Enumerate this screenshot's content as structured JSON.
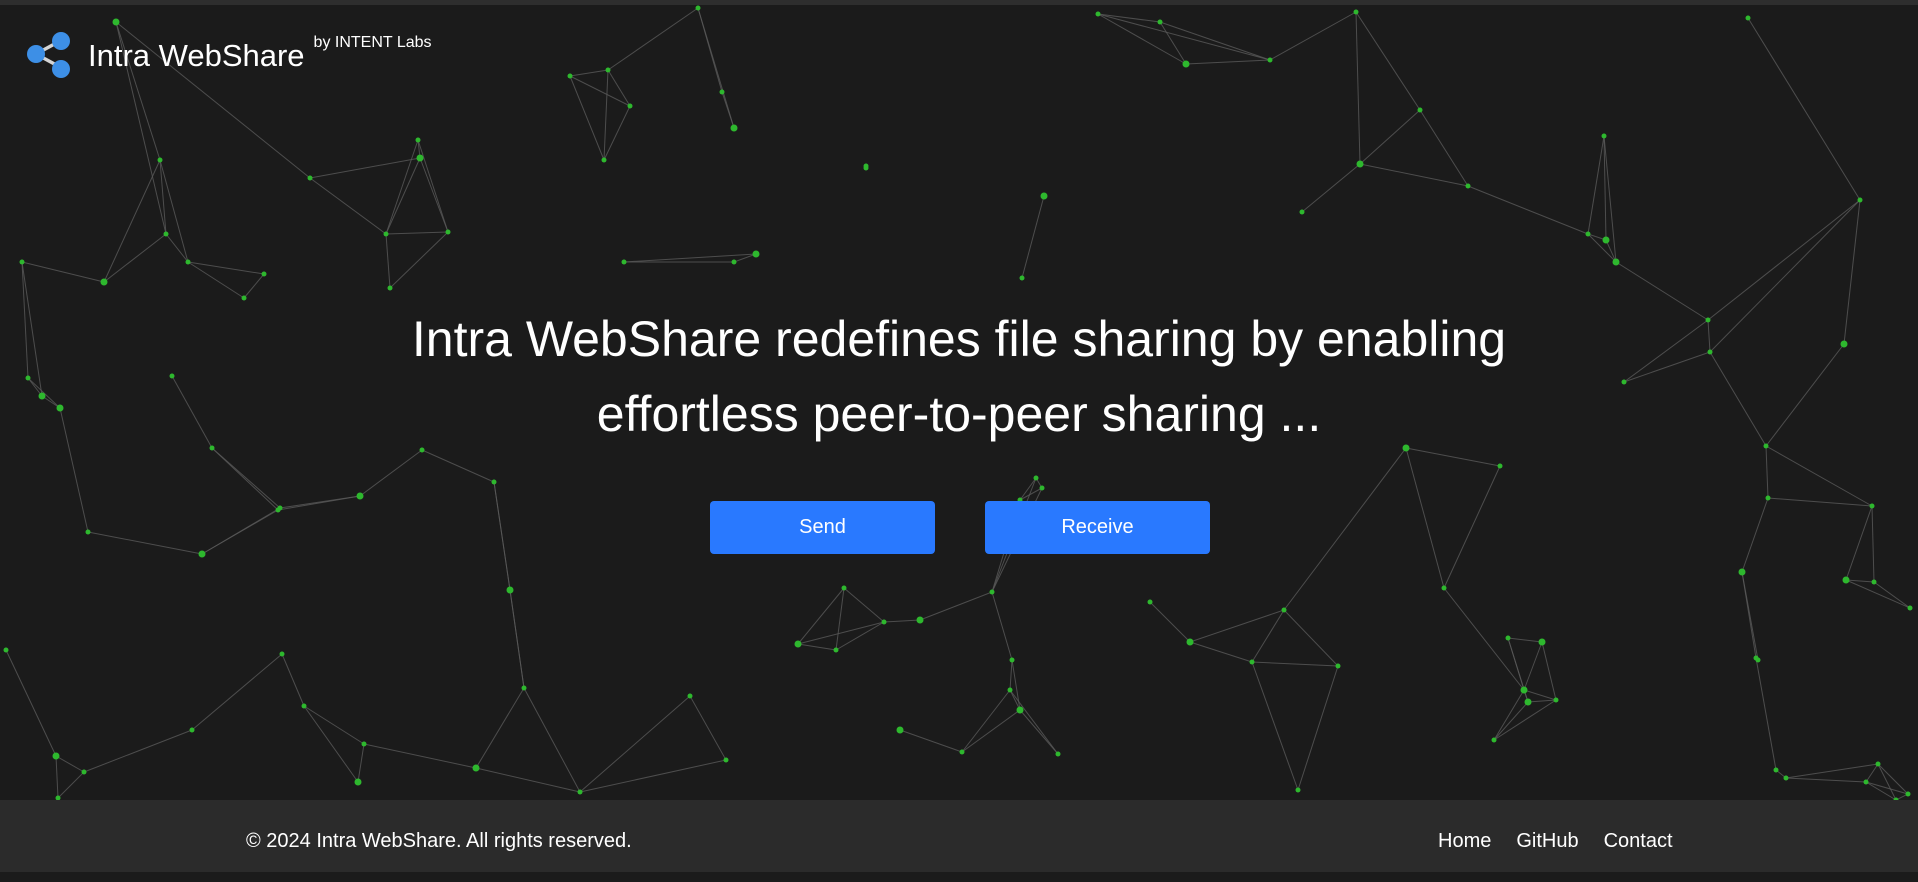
{
  "header": {
    "title": "Intra WebShare",
    "subtitle": "by INTENT Labs",
    "logo_icon": "share-icon",
    "logo_color": "#3d8fe6"
  },
  "hero": {
    "line1": "Intra WebShare redefines file sharing by enabling",
    "line2": "effortless peer-to-peer sharing ..."
  },
  "actions": {
    "send_label": "Send",
    "receive_label": "Receive",
    "button_color": "#2979ff"
  },
  "background": {
    "node_color": "#2eb82e",
    "link_color": "#5a5a5a"
  },
  "footer": {
    "copyright": "© 2024 Intra WebShare. All rights reserved.",
    "links": {
      "home": "Home",
      "github": "GitHub",
      "contact": "Contact"
    }
  }
}
